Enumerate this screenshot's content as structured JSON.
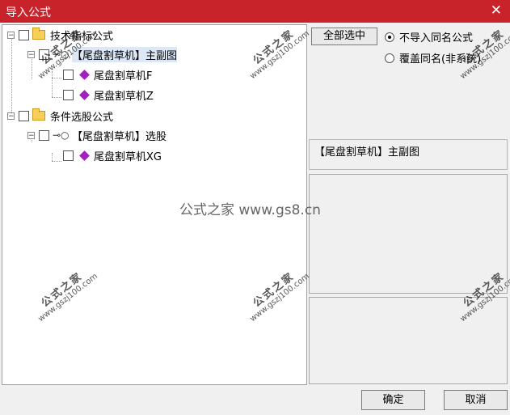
{
  "window": {
    "title": "导入公式",
    "close_icon": "✕"
  },
  "tree": {
    "nodes": [
      {
        "label": "技术指标公式",
        "expander": "−"
      },
      {
        "label": "【尾盘割草机】主副图",
        "expander": "−"
      },
      {
        "label": "尾盘割草机F"
      },
      {
        "label": "尾盘割草机Z"
      },
      {
        "label": "条件选股公式",
        "expander": "−"
      },
      {
        "label": "【尾盘割草机】选股",
        "expander": "−"
      },
      {
        "label": "尾盘割草机XG"
      }
    ],
    "key_icon": "⊸○"
  },
  "options": {
    "select_all_label": "全部选中",
    "radio_no_import": "不导入同名公式",
    "radio_overwrite": "覆盖同名(非系统)",
    "selected_radio": "no_import"
  },
  "info_text": "【尾盘割草机】主副图",
  "buttons": {
    "ok": "确定",
    "cancel": "取消"
  },
  "watermark": {
    "center": "公式之家 www.gs8.cn",
    "stamp_big": "公式之家",
    "stamp_small": "www.gszj100.com"
  },
  "colors": {
    "titlebar": "#c8222a",
    "gem": "#a020c0",
    "folder": "#f5cf58"
  }
}
